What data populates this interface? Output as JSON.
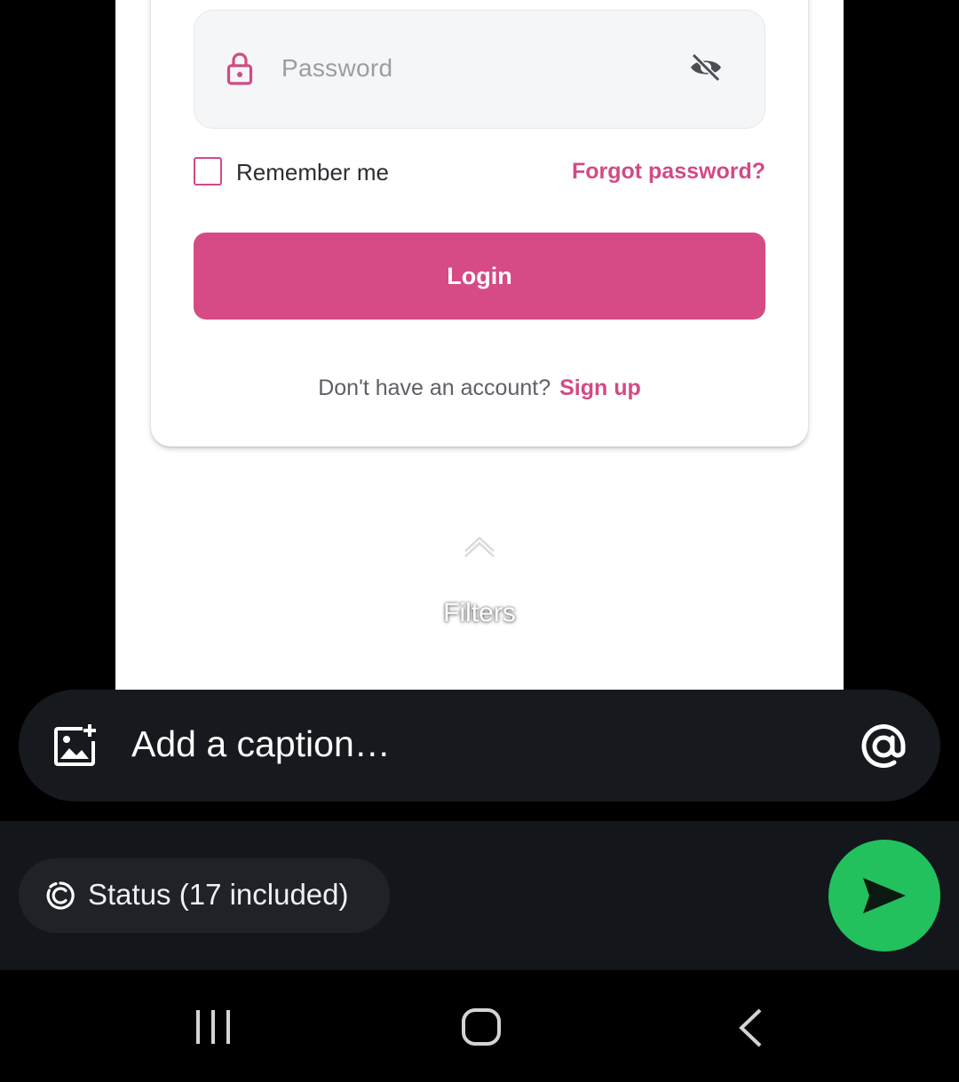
{
  "preview": {
    "password_placeholder": "Password",
    "remember_label": "Remember me",
    "forgot_label": "Forgot password?",
    "login_label": "Login",
    "signup_prompt": "Don't have an account?",
    "signup_link": "Sign up",
    "filters_label": "Filters"
  },
  "caption": {
    "placeholder": "Add a caption…",
    "left_icon": "add-image-icon",
    "right_icon": "mention-icon"
  },
  "footer": {
    "status_label": "Status (17 included)",
    "status_icon": "status-icon",
    "send_icon": "send-icon"
  },
  "navbar": {
    "icons": [
      "recents-icon",
      "home-icon",
      "back-icon"
    ]
  },
  "colors": {
    "accent_pink": "#d64a86",
    "send_green": "#22c15e",
    "dark_bar": "#16191d"
  }
}
